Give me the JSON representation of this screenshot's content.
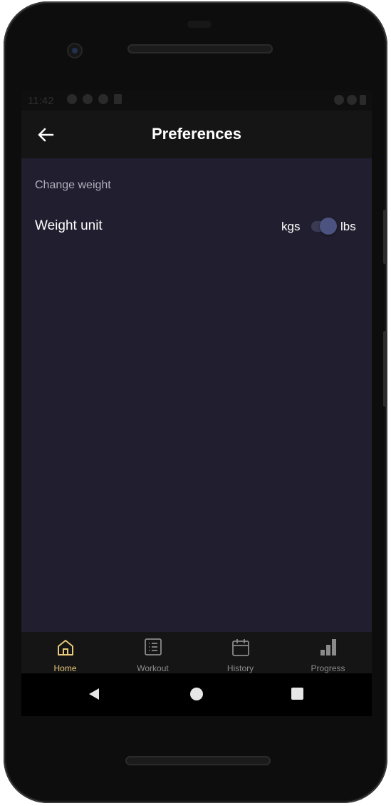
{
  "status_bar": {
    "time": "11:42"
  },
  "app_bar": {
    "title": "Preferences",
    "back_icon": "arrow-left-icon"
  },
  "section": {
    "label": "Change weight"
  },
  "weight_unit": {
    "label": "Weight unit",
    "left_option": "kgs",
    "right_option": "lbs",
    "selected": "lbs"
  },
  "bottom_nav": {
    "items": [
      {
        "label": "Home",
        "icon": "home-icon",
        "active": true
      },
      {
        "label": "Workout",
        "icon": "list-icon",
        "active": false
      },
      {
        "label": "History",
        "icon": "calendar-icon",
        "active": false
      },
      {
        "label": "Progress",
        "icon": "bar-chart-icon",
        "active": false
      }
    ]
  },
  "colors": {
    "content_bg": "#211f2f",
    "bar_bg": "#151515",
    "active_nav": "#e8c97a",
    "inactive_nav": "#8a8a8a"
  }
}
